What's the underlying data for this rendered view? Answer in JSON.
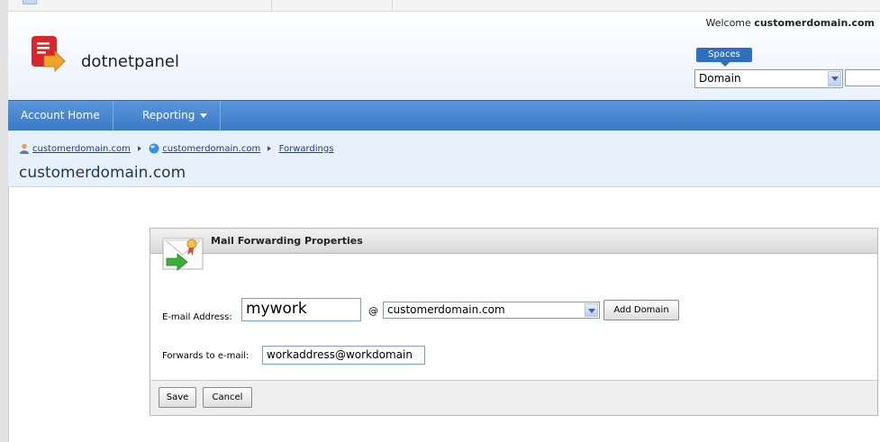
{
  "header": {
    "brand": "dotnetpanel",
    "welcome_prefix": "Welcome ",
    "welcome_user": "customerdomain.com",
    "spaces_label": "Spaces",
    "space_select_value": "Domain"
  },
  "nav": {
    "items": [
      {
        "label": "Account Home"
      },
      {
        "label": "Reporting"
      }
    ]
  },
  "breadcrumb": {
    "items": [
      "customerdomain.com",
      "customerdomain.com",
      "Forwardings"
    ]
  },
  "page_title": "customerdomain.com",
  "form": {
    "panel_title": "Mail Forwarding Properties",
    "email_label": "E-mail Address:",
    "email_local_value": "mywork",
    "at_symbol": "@",
    "domain_value": "customerdomain.com",
    "add_domain_label": "Add Domain",
    "forwards_label": "Forwards to e-mail:",
    "forwards_value": "workaddress@workdomain",
    "save_label": "Save",
    "cancel_label": "Cancel"
  },
  "colors": {
    "nav_blue": "#3b78c6",
    "accent_blue": "#2e6fc0",
    "logo_red": "#d9262a"
  }
}
